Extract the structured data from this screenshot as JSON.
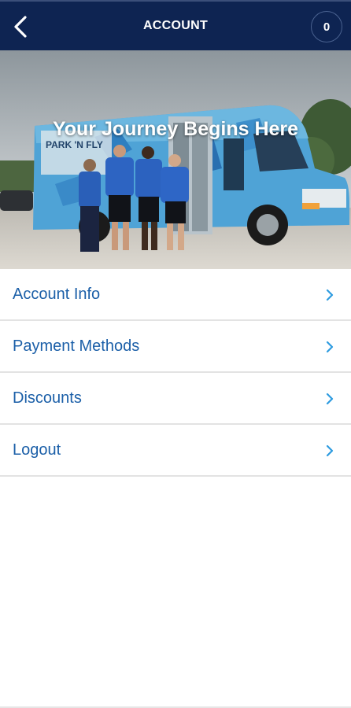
{
  "header": {
    "title": "ACCOUNT",
    "cart_count": "0",
    "back_icon": "back-arrow-icon",
    "background": "#0e2452"
  },
  "hero": {
    "title": "Your Journey Begins Here",
    "bus_text": "PARK 'N FLY"
  },
  "menu": {
    "items": [
      {
        "label": "Account Info",
        "icon": "chevron-right-icon"
      },
      {
        "label": "Payment Methods",
        "icon": "chevron-right-icon"
      },
      {
        "label": "Discounts",
        "icon": "chevron-right-icon"
      },
      {
        "label": "Logout",
        "icon": "chevron-right-icon"
      }
    ],
    "label_color": "#1b5fa8",
    "chevron_color": "#2d9be0"
  }
}
